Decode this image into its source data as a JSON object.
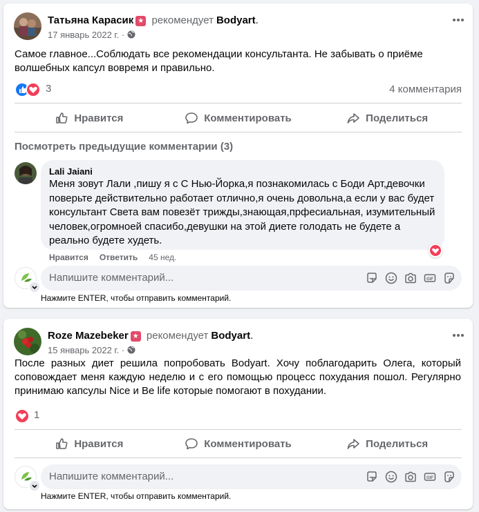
{
  "posts": [
    {
      "author": "Татьяна Карасик",
      "recommends": "рекомендует",
      "page": "Bodyart",
      "dot": ".",
      "date": "17 январь 2022 г.",
      "sep": "·",
      "text": "Самое главное...Соблюдать все рекомендации консультанта. Не забывать о приёме волшебных капсул вовремя и правильно.",
      "reaction_count": "3",
      "comment_count": "4 комментария",
      "actions": {
        "like": "Нравится",
        "comment": "Комментировать",
        "share": "Поделиться"
      },
      "previous_comments": "Посмотреть предыдущие комментарии (3)",
      "comment": {
        "author": "Lali Jaiani",
        "text": "Меня зовут Лали ,пишу я с С Нью-Йорка,я познакомилась с Боди Арт,девочки поверьте действительно работает отлично,я очень довольна,а если у вас будет консультант Света вам повезёт трижды,знающая,прфесиальная, изумительный человек,огромноей спасибо,девушки на этой диете голодать не будете а реально будете худеть.",
        "like": "Нравится",
        "reply": "Ответить",
        "time": "45 нед."
      },
      "write_placeholder": "Напишите комментарий...",
      "hint": "Нажмите ENTER, чтобы отправить комментарий."
    },
    {
      "author": "Roze Mazebeker",
      "recommends": "рекомендует",
      "page": "Bodyart",
      "dot": ".",
      "date": "15 январь 2022 г.",
      "sep": "·",
      "text": "После разных диет решила попробовать Bodyart. Хочу поблагодарить Олега, который соповождает меня каждую неделю и с его помощью процесс похудания пошол. Регулярно принимаю капсулы Nice и Be life которые помогают в похудании.",
      "reaction_count": "1",
      "actions": {
        "like": "Нравится",
        "comment": "Комментировать",
        "share": "Поделиться"
      },
      "write_placeholder": "Напишите комментарий...",
      "hint": "Нажмите ENTER, чтобы отправить комментарий."
    }
  ],
  "icons": {
    "like": "thumbs-up-icon",
    "comment": "speech-bubble-icon",
    "share": "share-arrow-icon",
    "globe": "globe-icon",
    "more": "more-dots-icon",
    "write_icons": [
      "sticker-icon",
      "emoji-icon",
      "camera-icon",
      "gif-icon",
      "sticker-smile-icon"
    ]
  },
  "colors": {
    "accent": "#1877f2",
    "love": "#f33e58",
    "muted": "#65676b",
    "background": "#f0f2f5",
    "badge": "#e24a69"
  }
}
